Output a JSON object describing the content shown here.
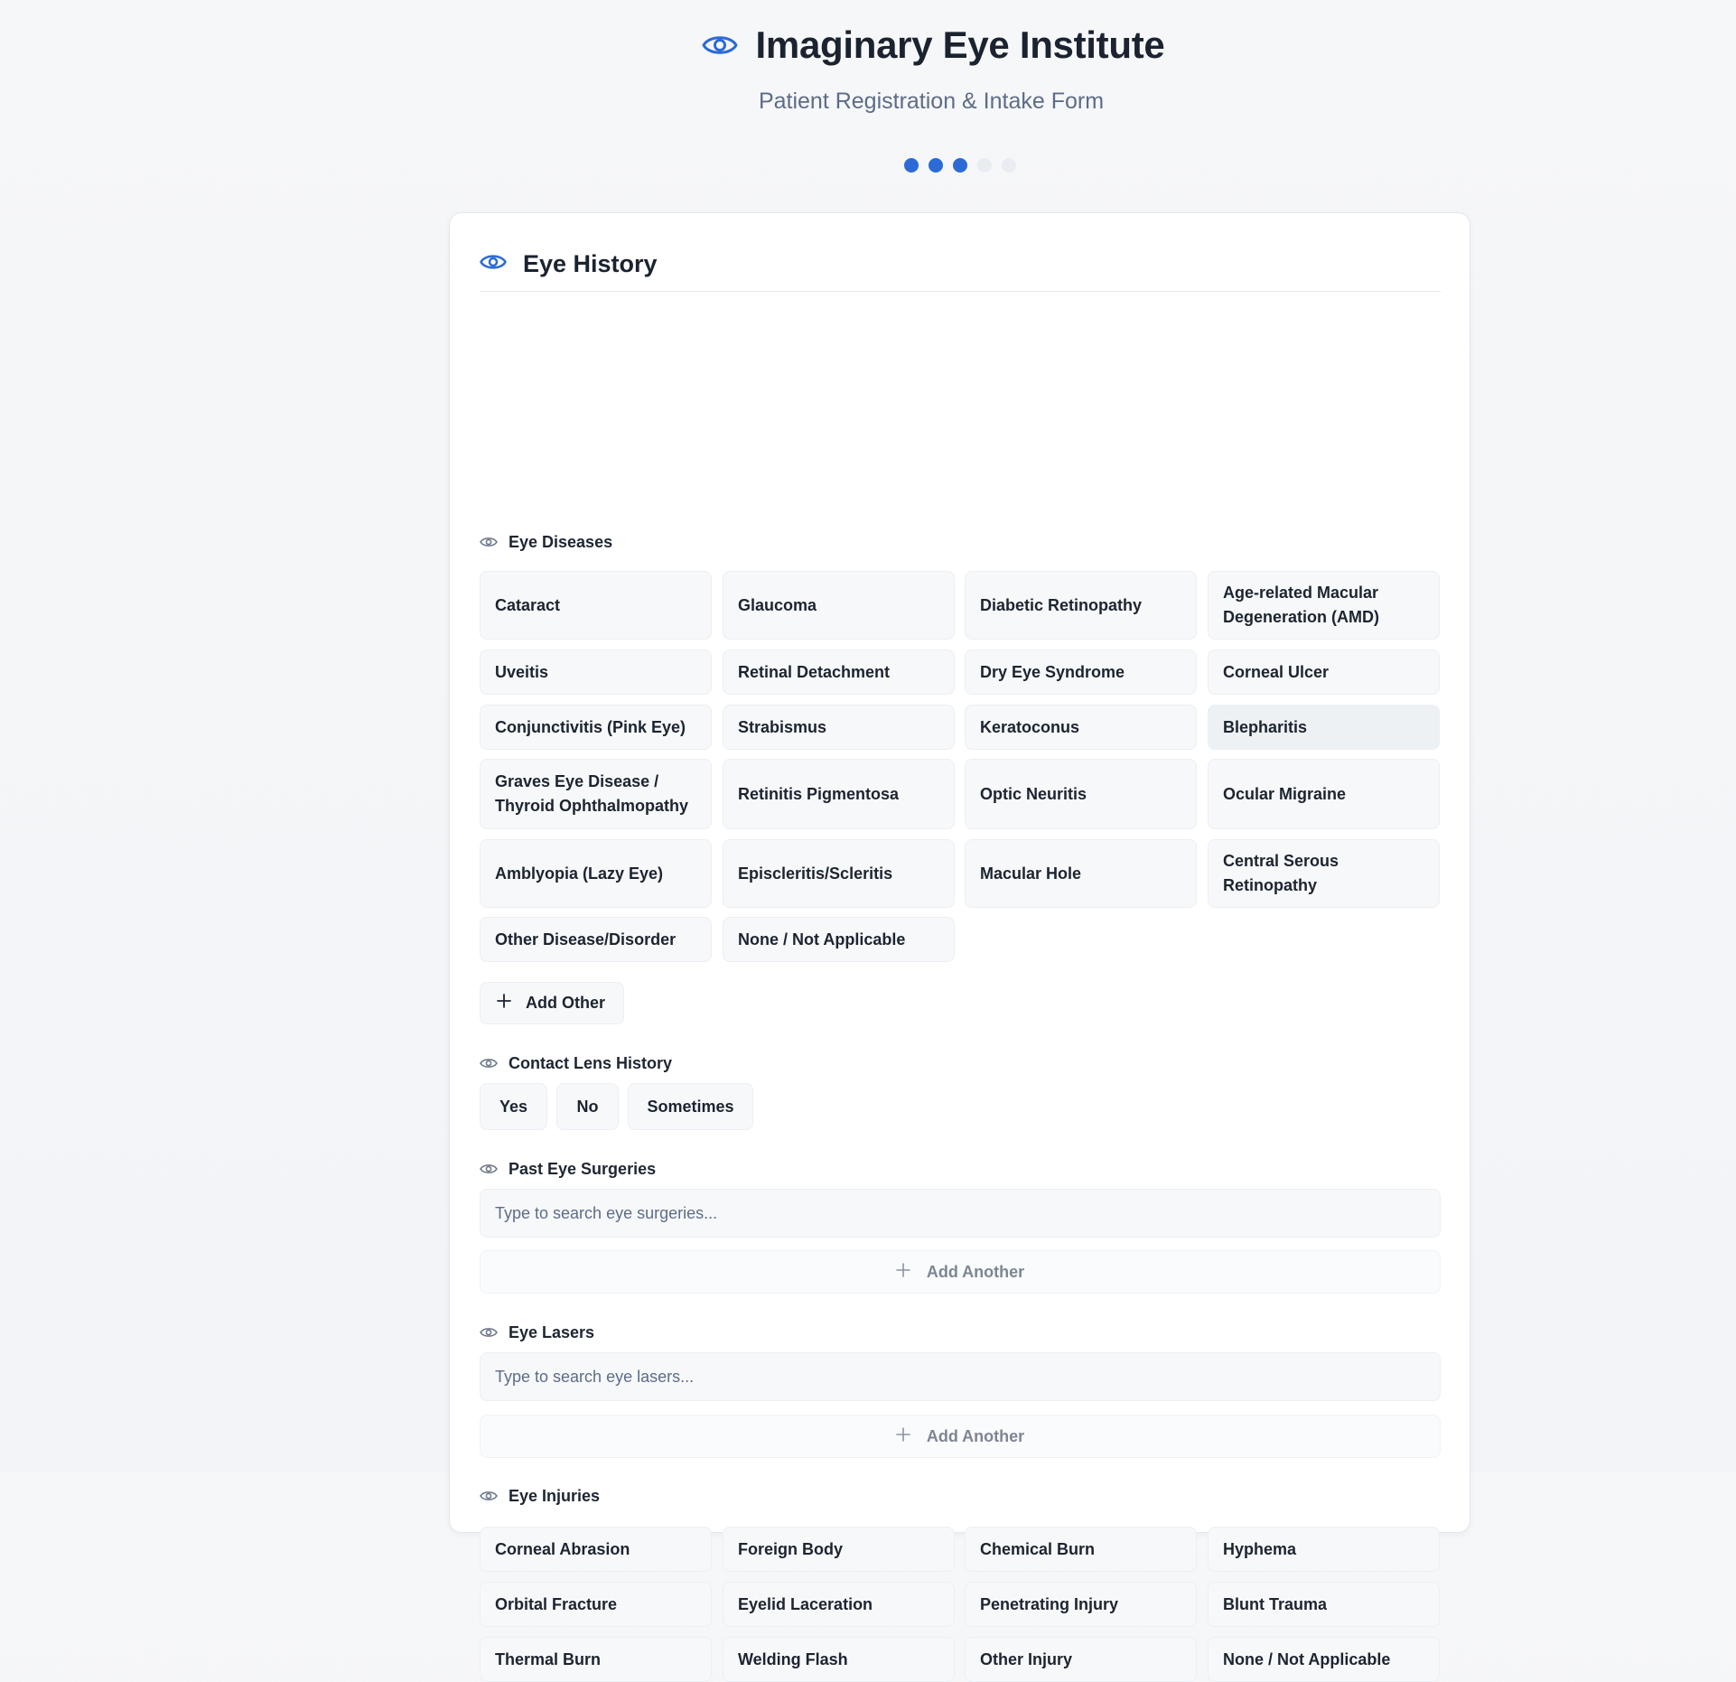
{
  "header": {
    "title": "Imaginary Eye Institute",
    "subtitle": "Patient Registration & Intake Form",
    "logo_icon": "eye-icon",
    "progress": {
      "total_steps": 5,
      "completed_steps": 3
    }
  },
  "colors": {
    "accent": "#2c6bd6",
    "text_primary": "#1b2330",
    "text_muted": "#5d6c87"
  },
  "card": {
    "title": "Eye History",
    "title_icon": "eye-icon"
  },
  "eye_diseases": {
    "label": "Eye Diseases",
    "options": [
      "Cataract",
      "Glaucoma",
      "Diabetic Retinopathy",
      "Age-related Macular Degeneration (AMD)",
      "Uveitis",
      "Retinal Detachment",
      "Dry Eye Syndrome",
      "Corneal Ulcer",
      "Conjunctivitis (Pink Eye)",
      "Strabismus",
      "Keratoconus",
      "Blepharitis",
      "Graves Eye Disease / Thyroid Ophthalmopathy",
      "Retinitis Pigmentosa",
      "Optic Neuritis",
      "Ocular Migraine",
      "Amblyopia (Lazy Eye)",
      "Episcleritis/Scleritis",
      "Macular Hole",
      "Central Serous Retinopathy",
      "Other Disease/Disorder",
      "None / Not Applicable"
    ],
    "add_other_label": "Add Other"
  },
  "contact_lens": {
    "label": "Contact Lens History",
    "options": [
      "Yes",
      "No",
      "Sometimes"
    ]
  },
  "past_surgeries": {
    "label": "Past Eye Surgeries",
    "placeholder": "Type to search eye surgeries...",
    "add_another_label": "Add Another"
  },
  "eye_lasers": {
    "label": "Eye Lasers",
    "placeholder": "Type to search eye lasers...",
    "add_another_label": "Add Another"
  },
  "eye_injuries": {
    "label": "Eye Injuries",
    "options": [
      "Corneal Abrasion",
      "Foreign Body",
      "Chemical Burn",
      "Hyphema",
      "Orbital Fracture",
      "Eyelid Laceration",
      "Penetrating Injury",
      "Blunt Trauma",
      "Thermal Burn",
      "Welding Flash",
      "Other Injury",
      "None / Not Applicable"
    ]
  }
}
